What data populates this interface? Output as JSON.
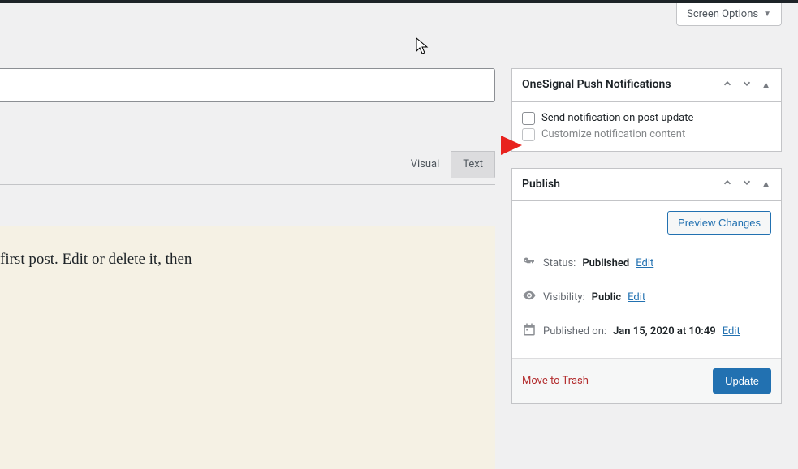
{
  "screen_options_label": "Screen Options",
  "editor": {
    "tab_visual": "Visual",
    "tab_text": "Text",
    "content_text": "first post. Edit or delete it, then"
  },
  "onesignal": {
    "box_title": "OneSignal Push Notifications",
    "opt_send": "Send notification on post update",
    "opt_customize": "Customize notification content"
  },
  "publish": {
    "box_title": "Publish",
    "preview_label": "Preview Changes",
    "status_label": "Status:",
    "status_value": "Published",
    "visibility_label": "Visibility:",
    "visibility_value": "Public",
    "published_label": "Published on:",
    "published_value": "Jan 15, 2020 at 10:49",
    "edit_link": "Edit",
    "trash_label": "Move to Trash",
    "update_label": "Update"
  }
}
